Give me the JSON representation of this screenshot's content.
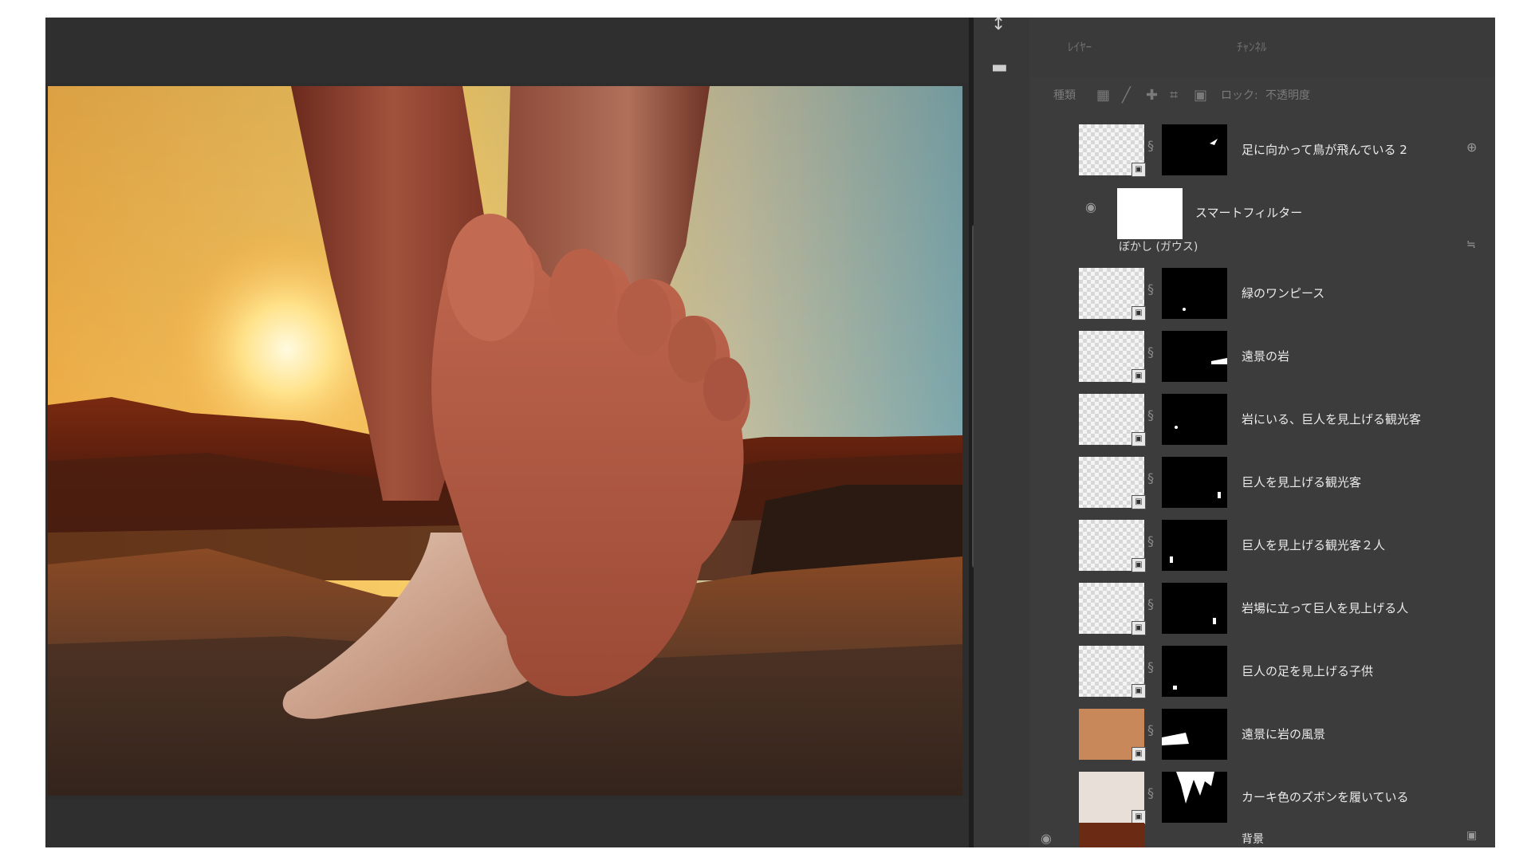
{
  "panel": {
    "tabs": [
      "ﾚｲﾔｰ",
      "ﾁｬﾝﾈﾙ"
    ],
    "toolbar": {
      "kind_label": "種類",
      "lock_label": "ロック:",
      "opacity_label": "不透明度"
    },
    "layers": [
      {
        "name": "足に向かって鳥が飛んでいる 2",
        "has_fx": true
      },
      {
        "name": "緑のワンピース"
      },
      {
        "name": "遠景の岩"
      },
      {
        "name": "岩にいる、巨人を見上げる観光客"
      },
      {
        "name": "巨人を見上げる観光客"
      },
      {
        "name": "巨人を見上げる観光客２人"
      },
      {
        "name": "岩場に立って巨人を見上げる人"
      },
      {
        "name": "巨人の足を見上げる子供"
      },
      {
        "name": "遠景に岩の風景"
      },
      {
        "name": "カーキ色のズボンを履いている"
      }
    ],
    "smart_filter": {
      "label": "スマートフィルター",
      "sub_label": "ぼかし (ガウス)"
    },
    "bottom_layer": {
      "name": "背景"
    }
  }
}
